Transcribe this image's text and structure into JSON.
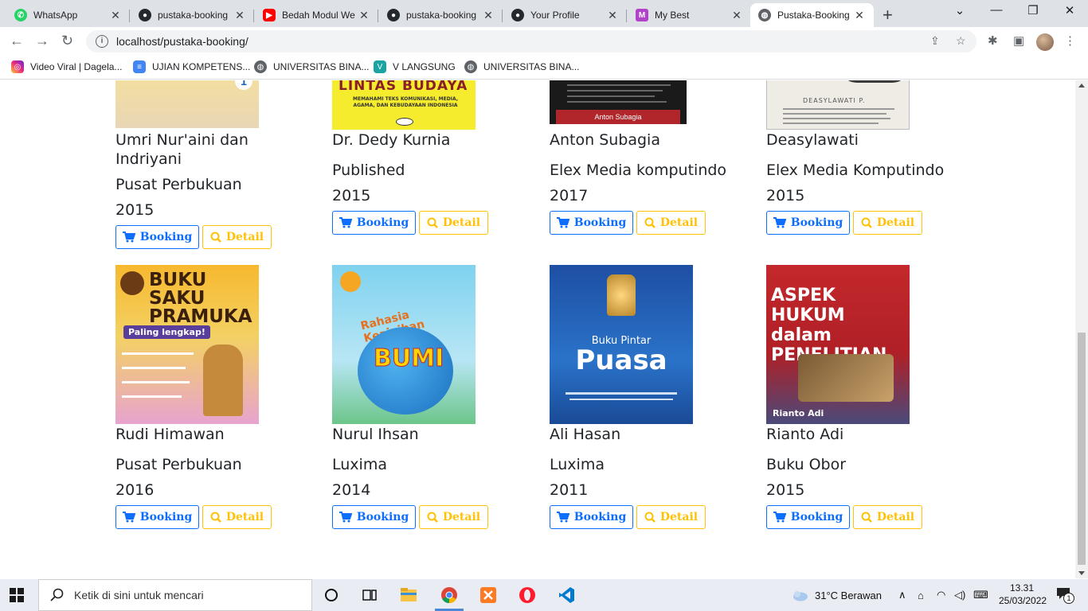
{
  "browser": {
    "tabs": [
      {
        "title": "WhatsApp",
        "icon": "whatsapp-icon",
        "color": "#25d366"
      },
      {
        "title": "pustaka-booking",
        "icon": "github-icon",
        "color": "#24292f"
      },
      {
        "title": "Bedah Modul We",
        "icon": "youtube-icon",
        "color": "#ff0000"
      },
      {
        "title": "pustaka-booking",
        "icon": "github-icon",
        "color": "#24292f"
      },
      {
        "title": "Your Profile",
        "icon": "github-icon",
        "color": "#24292f"
      },
      {
        "title": "My Best",
        "icon": "maze-icon",
        "color": "#b043c9"
      },
      {
        "title": "Pustaka-Booking",
        "icon": "globe-icon",
        "color": "#5f6368"
      }
    ],
    "url": "localhost/pustaka-booking/",
    "bookmarks": [
      {
        "label": "Video Viral | Dagela...",
        "icon": "instagram-icon",
        "color": "#e1306c"
      },
      {
        "label": "UJIAN KOMPETENS...",
        "icon": "forms-icon",
        "color": "#4285f4"
      },
      {
        "label": "UNIVERSITAS BINA...",
        "icon": "globe-icon",
        "color": "#5f6368"
      },
      {
        "label": "V LANGSUNG",
        "icon": "v-icon",
        "color": "#1aa3a3"
      },
      {
        "label": "UNIVERSITAS BINA...",
        "icon": "globe-icon",
        "color": "#5f6368"
      }
    ]
  },
  "buttons": {
    "booking": "Booking",
    "detail": "Detail",
    "primary_color": "#0d6efd",
    "warning_color": "#ffc107"
  },
  "books_row1": [
    {
      "author": "Umri Nur'aini dan Indriyani",
      "publisher": "Pusat Perbukuan",
      "year": "2015",
      "cover_title": ""
    },
    {
      "author": "Dr. Dedy Kurnia",
      "publisher": "Published",
      "year": "2015",
      "cover_title": "LINTAS BUDAYA",
      "cover_sub": "MEMAHAMI TEKS KOMUNIKASI, MEDIA, AGAMA, DAN KEBUDAYAAN INDONESIA"
    },
    {
      "author": "Anton Subagia",
      "publisher": "Elex Media komputindo",
      "year": "2017",
      "cover_title": "Anton Subagia"
    },
    {
      "author": "Deasylawati",
      "publisher": "Elex Media Komputindo",
      "year": "2015",
      "cover_title": "DEASYLAWATI P."
    }
  ],
  "books_row2": [
    {
      "author": "Rudi Himawan",
      "publisher": "Pusat Perbukuan",
      "year": "2016",
      "cover_title": "BUKU SAKU PRAMUKA",
      "cover_sub": "Paling lengkap!"
    },
    {
      "author": "Nurul Ihsan",
      "publisher": "Luxima",
      "year": "2014",
      "cover_title": "BUMI",
      "cover_sub": "Rahasia Keajaiban"
    },
    {
      "author": "Ali Hasan",
      "publisher": "Luxima",
      "year": "2011",
      "cover_title": "Puasa",
      "cover_sub": "Buku Pintar"
    },
    {
      "author": "Rianto Adi",
      "publisher": "Buku Obor",
      "year": "2015",
      "cover_title": "ASPEK HUKUM dalam PENELITIAN",
      "cover_sub": "Rianto Adi"
    }
  ],
  "taskbar": {
    "search_placeholder": "Ketik di sini untuk mencari",
    "weather": "31°C  Berawan",
    "time": "13.31",
    "date": "25/03/2022",
    "notifications": "1"
  }
}
